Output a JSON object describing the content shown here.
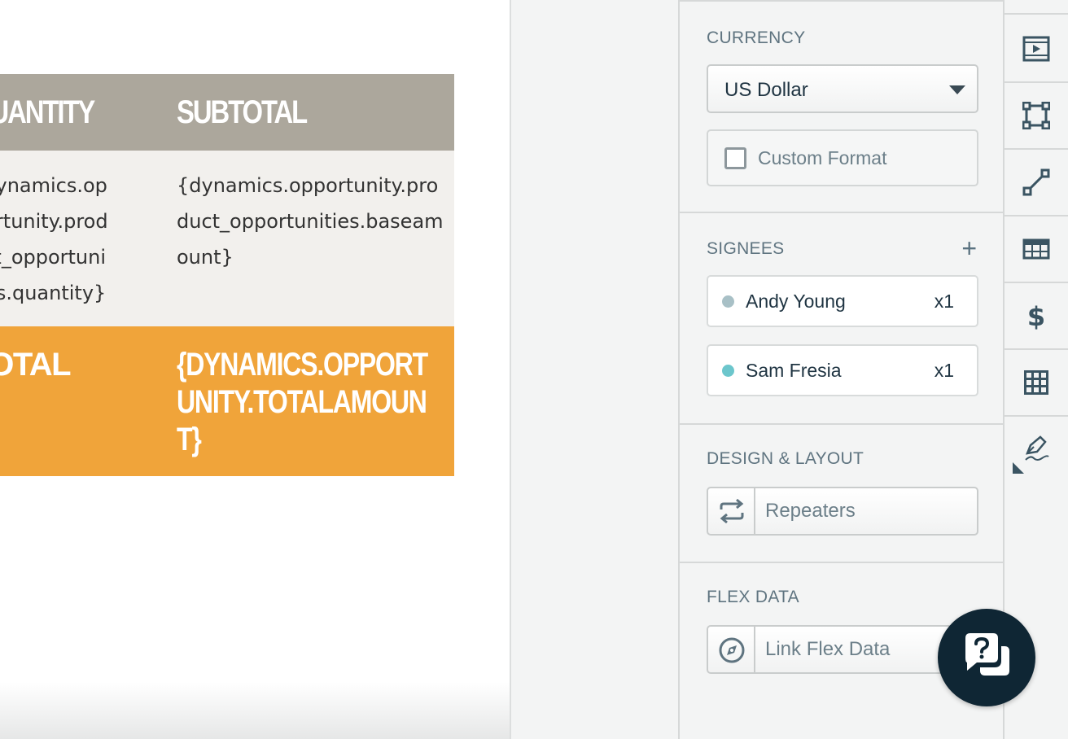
{
  "document": {
    "table": {
      "headers": [
        "QUANTITY",
        "SUBTOTAL"
      ],
      "row": [
        "{dynamics.opportunity.product_opportunities.quantity}",
        "{dynamics.opportunity.product_opportunities.baseamount}"
      ],
      "total": [
        "TOTAL",
        "{DYNAMICS.OPPORTUNITY.TOTALAMOUNT}"
      ]
    }
  },
  "panel": {
    "currency": {
      "title": "CURRENCY",
      "selected": "US Dollar",
      "custom_format_label": "Custom Format"
    },
    "signees": {
      "title": "SIGNEES",
      "add_icon": "plus-icon",
      "items": [
        {
          "name": "Andy Young",
          "count": "x1",
          "dot_color": "#a8c0c6"
        },
        {
          "name": "Sam Fresia",
          "count": "x1",
          "dot_color": "#6cc6cc"
        }
      ]
    },
    "design": {
      "title": "DESIGN & LAYOUT",
      "repeaters_label": "Repeaters",
      "repeaters_icon": "repeat-icon"
    },
    "flex": {
      "title": "FLEX DATA",
      "link_label": "Link Flex Data",
      "link_icon": "compass-icon"
    }
  },
  "toolbar": {
    "tools": [
      "video-icon",
      "shape-icon",
      "line-icon",
      "table-icon",
      "dollar-icon",
      "grid-icon",
      "signature-pen-icon"
    ]
  },
  "help": {
    "icon": "help-chat-icon"
  },
  "colors": {
    "header_bg": "#aca79c",
    "body_bg": "#f2f0ed",
    "total_bg": "#f0a43a",
    "icon_color": "#3a5462",
    "help_bg": "#0f2634"
  }
}
